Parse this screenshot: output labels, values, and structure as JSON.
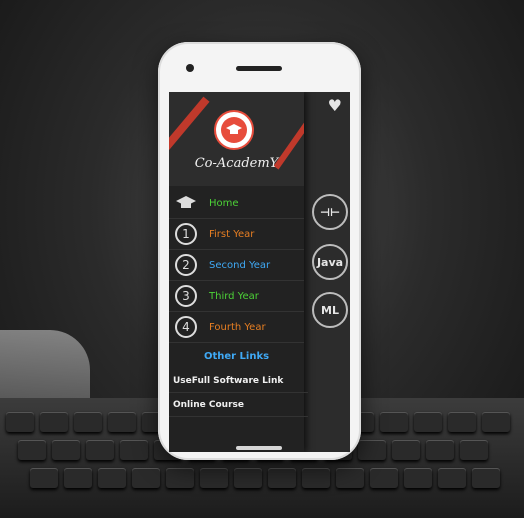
{
  "app": {
    "title": "Co-AcademY"
  },
  "nav": [
    {
      "label": "Home",
      "icon": "graduation-cap-icon",
      "glyph": "🎓",
      "color": "#4cd137"
    },
    {
      "label": "First Year",
      "icon": "number-1-icon",
      "glyph": "1",
      "color": "#e67e22"
    },
    {
      "label": "Second Year",
      "icon": "number-2-icon",
      "glyph": "2",
      "color": "#3fa9f5"
    },
    {
      "label": "Third Year",
      "icon": "number-3-icon",
      "glyph": "3",
      "color": "#4cd137"
    },
    {
      "label": "Fourth Year",
      "icon": "number-4-icon",
      "glyph": "4",
      "color": "#e67e22"
    }
  ],
  "other_links": {
    "header": "Other Links",
    "items": [
      "UseFull Software Link",
      "Online Course"
    ]
  },
  "background_course_icons": [
    "Java",
    "ML"
  ],
  "colors": {
    "accent_red": "#c0392b",
    "drawer_bg": "#222222",
    "link_blue": "#3fa9f5"
  }
}
